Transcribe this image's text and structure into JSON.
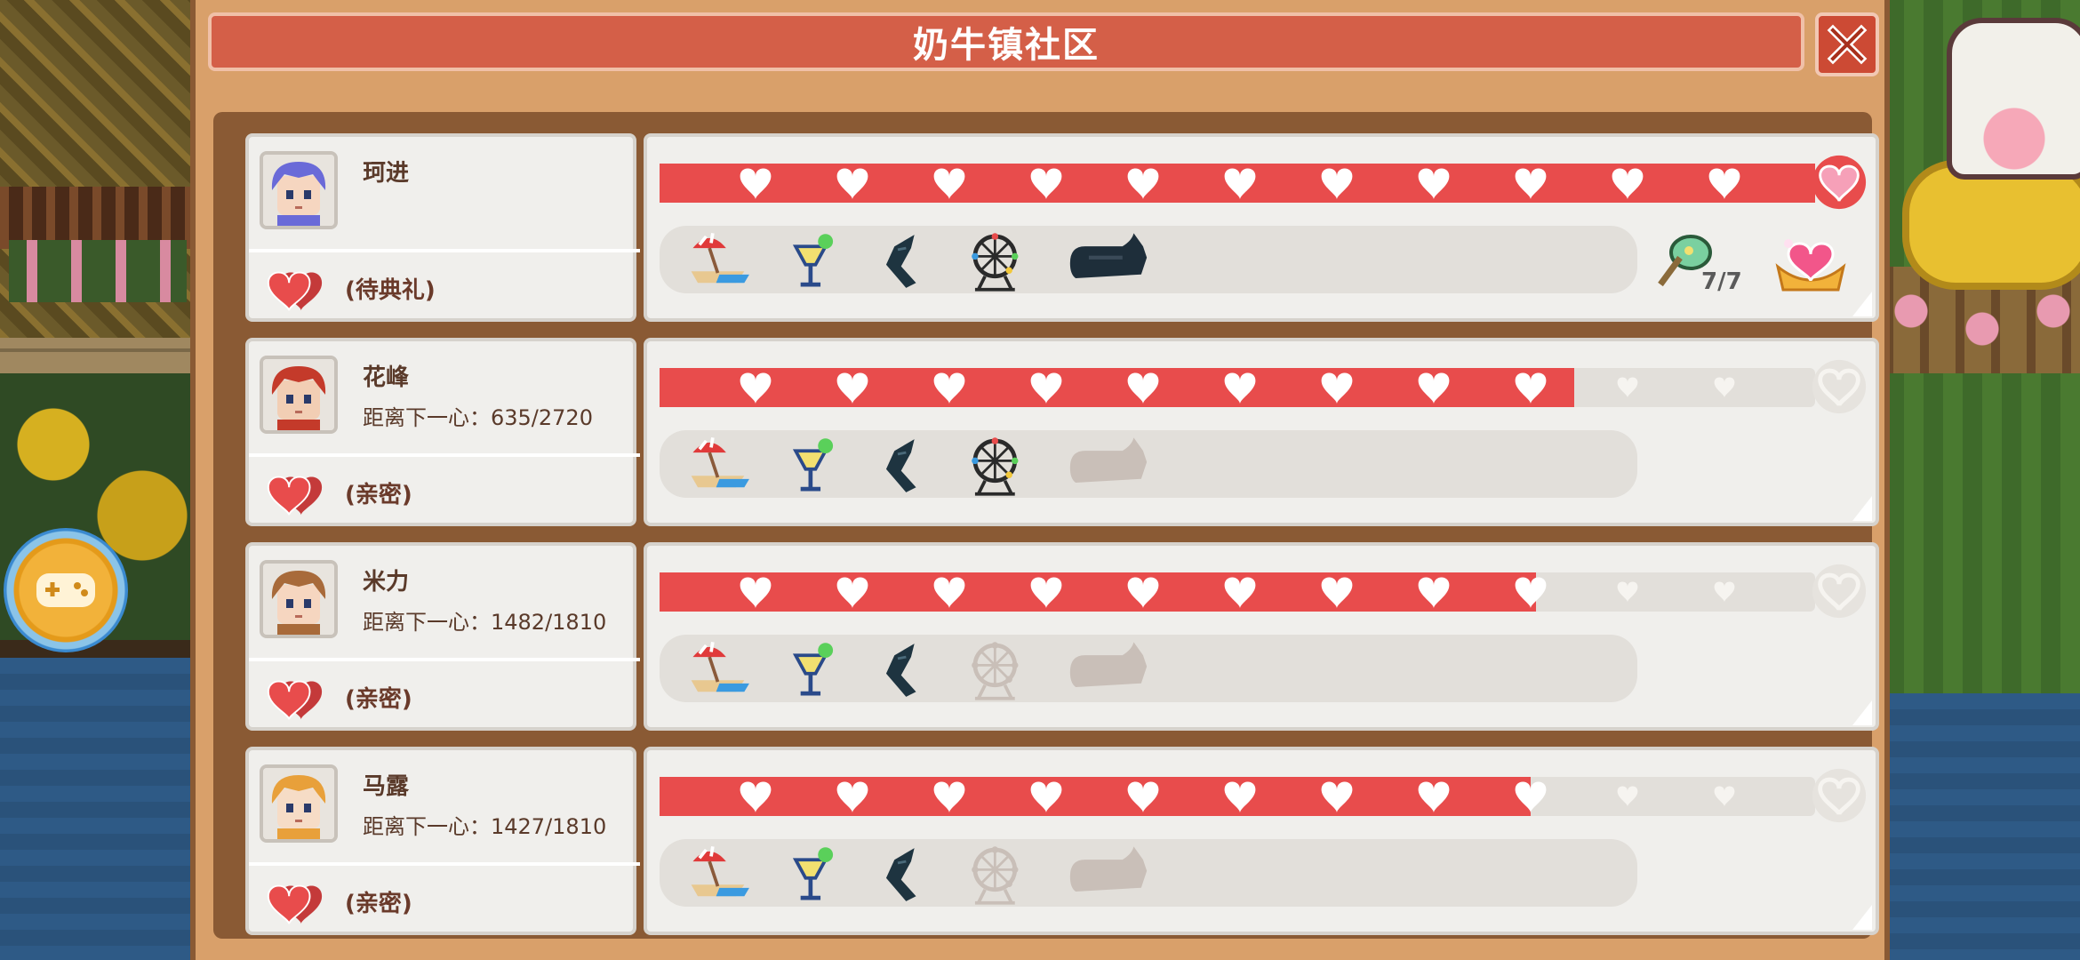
{
  "title": "奶牛镇社区",
  "colors": {
    "bar_fill": "#e84c4c",
    "bar_empty": "#e2dfda",
    "title_bg": "#d45f48",
    "frame": "#d9a06a"
  },
  "hearts_total": 12,
  "gift_icons": [
    "beach-umbrella-icon",
    "cocktail-glass-icon",
    "dark-fish-icon",
    "ferris-wheel-icon",
    "sheep-icon"
  ],
  "villagers": [
    {
      "name": "珂进",
      "distance": "",
      "status": "(待典礼)",
      "hearts_filled": 12,
      "partial": 0,
      "gifts_unlocked": 5,
      "gift_count": "7/7",
      "avatar_hair": "#6a6ad8",
      "avatar_skin": "#f6d6c0"
    },
    {
      "name": "花峰",
      "distance": "距离下一心：635/2720",
      "status": "(亲密)",
      "hearts_filled": 9,
      "partial": 0.5,
      "gifts_unlocked": 4,
      "gift_count": "",
      "avatar_hair": "#c43a2a",
      "avatar_skin": "#f2ceb4"
    },
    {
      "name": "米力",
      "distance": "距离下一心：1482/1810",
      "status": "(亲密)",
      "hearts_filled": 9,
      "partial": 0.1,
      "gifts_unlocked": 3,
      "gift_count": "",
      "avatar_hair": "#a86a3a",
      "avatar_skin": "#f6d6c0"
    },
    {
      "name": "马露",
      "distance": "距离下一心：1427/1810",
      "status": "(亲密)",
      "hearts_filled": 9,
      "partial": 0.05,
      "gifts_unlocked": 3,
      "gift_count": "",
      "avatar_hair": "#e8a03a",
      "avatar_skin": "#f6dcc6"
    }
  ]
}
